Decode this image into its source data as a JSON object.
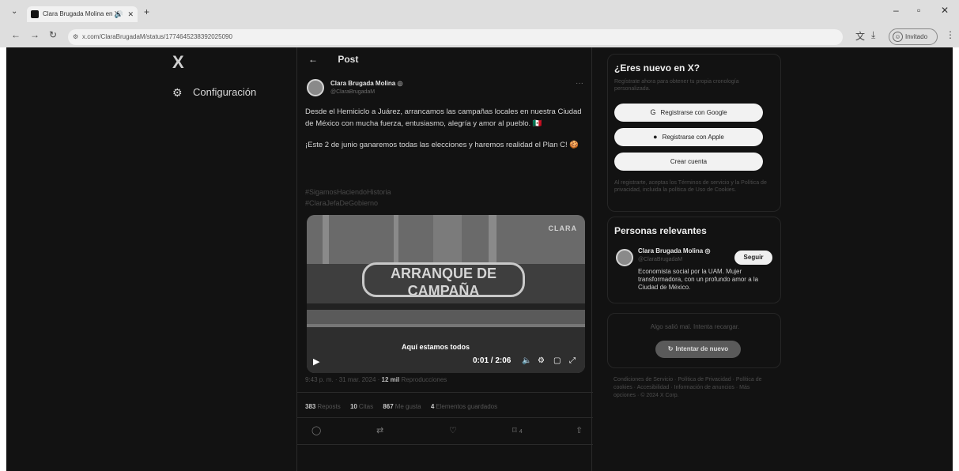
{
  "browser": {
    "tab_title": "Clara Brugada Molina en X",
    "url": "x.com/ClaraBrugadaM/status/1774645238392025090",
    "profile_label": "Invitado",
    "icons": {
      "tab_dropdown": "chevron-down-icon",
      "back": "arrow-left-icon",
      "forward": "arrow-right-icon",
      "reload": "reload-icon",
      "translate": "translate-icon",
      "download": "download-icon",
      "menu": "kebab-menu-icon"
    }
  },
  "sidebar": {
    "logo": "X",
    "items": [
      {
        "label": "Configuración",
        "icon": "gear-icon"
      }
    ]
  },
  "post": {
    "header_label": "Post",
    "author": {
      "name": "Clara Brugada Molina",
      "handle": "@ClaraBrugadaM"
    },
    "paragraphs": [
      "Desde el Hemiciclo a Juárez, arrancamos las campañas locales en nuestra Ciudad de México con mucha fuerza, entusiasmo, alegría y amor al pueblo. 🇲🇽",
      "¡Este 2 de junio ganaremos todas las elecciones y haremos realidad el Plan C! 🍪"
    ],
    "hashtags": [
      "#SigamosHaciendoHistoria",
      "#ClaraJefaDeGobierno"
    ],
    "media": {
      "banner_text": "ARRANQUE DE CAMPAÑA",
      "sign_text": "CLARA",
      "caption": "Aquí estamos todos",
      "time": "0:01 / 2:06"
    },
    "meta": {
      "time": "9:43 p. m.",
      "date": "31 mar. 2024",
      "views": "12 mil",
      "views_label": "Reproducciones"
    },
    "stats": [
      {
        "value": "383",
        "label": "Reposts"
      },
      {
        "value": "10",
        "label": "Citas"
      },
      {
        "value": "867",
        "label": "Me gusta"
      },
      {
        "value": "4",
        "label": "Elementos guardados"
      }
    ],
    "actions": {
      "reply_icon": "reply-icon",
      "repost_icon": "repost-icon",
      "like_icon": "heart-icon",
      "bookmark_icon": "bookmark-icon",
      "bookmark_count": "4",
      "share_icon": "share-icon"
    }
  },
  "signup": {
    "title": "¿Eres nuevo en X?",
    "description": "Regístrate ahora para obtener tu propia cronología personalizada.",
    "google_button": "Registrarse con Google",
    "apple_button": "Registrarse con Apple",
    "create_button": "Crear cuenta",
    "legal": "Al registrarte, aceptas los Términos de servicio y la Política de privacidad, incluida la política de Uso de Cookies."
  },
  "people": {
    "title": "Personas relevantes",
    "person": {
      "name": "Clara Brugada Molina",
      "handle": "@ClaraBrugadaM",
      "follow_label": "Seguir",
      "bio": "Economista social por la UAM. Mujer transformadora, con un profundo amor a la Ciudad de México."
    }
  },
  "error_panel": {
    "message": "Algo salió mal. Intenta recargar.",
    "retry_label": "Intentar de nuevo"
  },
  "footer": {
    "text": "Condiciones de Servicio · Política de Privacidad · Política de cookies · Accesibilidad · Información de anuncios · Más opciones · © 2024 X Corp."
  },
  "colors": {
    "page_bg": "#121212",
    "pill_bg": "#f2f2f2",
    "retry_bg": "#5a5a5a"
  }
}
